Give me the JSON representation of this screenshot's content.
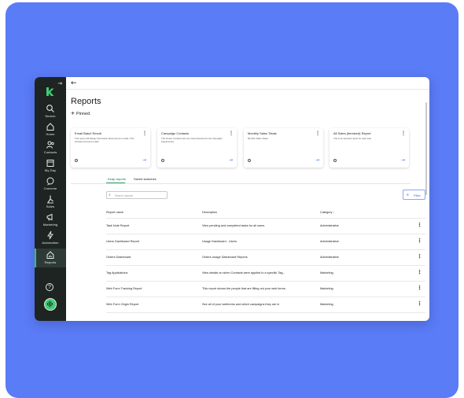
{
  "sidebar": {
    "collapse_icon": "collapse-panel-icon",
    "logo_icon": "k-logo-icon",
    "items": [
      {
        "label": "Search",
        "icon": "search-icon"
      },
      {
        "label": "Home",
        "icon": "home-icon"
      },
      {
        "label": "Contacts",
        "icon": "contacts-icon"
      },
      {
        "label": "My Day",
        "icon": "calendar-icon"
      },
      {
        "label": "Convene",
        "icon": "chat-icon"
      },
      {
        "label": "Sales",
        "icon": "sales-icon"
      },
      {
        "label": "Marketing",
        "icon": "marketing-icon"
      },
      {
        "label": "Automation",
        "icon": "automation-icon"
      },
      {
        "label": "Reports",
        "icon": "reports-icon",
        "active": true
      }
    ],
    "help_label": "?",
    "accent": "#33c26f",
    "bg": "#1e2422"
  },
  "header": {
    "back_icon": "←",
    "title": "Reports",
    "pinned_label": "Pinned",
    "pin_icon": "✈"
  },
  "pinned_cards": [
    {
      "title": "Email Batch Result",
      "desc": "This report will display information about all your emails. This includes bounced emails",
      "arrow": "→"
    },
    {
      "title": "Campaign Contacts",
      "desc": "This shows Contacts who are in/ap interested to the Campaign Sequence(s)",
      "arrow": "→"
    },
    {
      "title": "Monthly Sales Totals",
      "desc": "Monthly Sales Totals",
      "arrow": "→"
    },
    {
      "title": "All Sales (Itemized) Report",
      "desc": "This is an itemized report for each sale",
      "arrow": "→"
    }
  ],
  "tabs": [
    {
      "label": "Keap reports",
      "active": true
    },
    {
      "label": "Saved searches",
      "active": false
    }
  ],
  "search": {
    "placeholder": "Search reports"
  },
  "filter": {
    "label": "Filter"
  },
  "table": {
    "headers": [
      "Report name",
      "Description",
      "Category ↑"
    ],
    "rows": [
      [
        "Task Note Report",
        "View pending and completed tasks for all users",
        "Administrative"
      ],
      [
        "Users Dashboard Report",
        "Usage Dashboard - Users",
        "Administrative"
      ],
      [
        "Orders Dashboard",
        "Orders Usage Dashboard Reports",
        "Administrative"
      ],
      [
        "Tag Applications",
        "View details on when Contacts were applied to a specific Tag...",
        "Marketing"
      ],
      [
        "Web Form Tracking Report",
        "This report shows the people that are filling out your web forms.",
        "Marketing"
      ],
      [
        "Web Form Origin Report",
        "See all of your webforms and which campaigns they are in",
        "Marketing"
      ]
    ]
  },
  "colors": {
    "page_bg": "#5b7cf7",
    "link_blue": "#3a6fe8",
    "tab_green": "#2e9e66"
  }
}
